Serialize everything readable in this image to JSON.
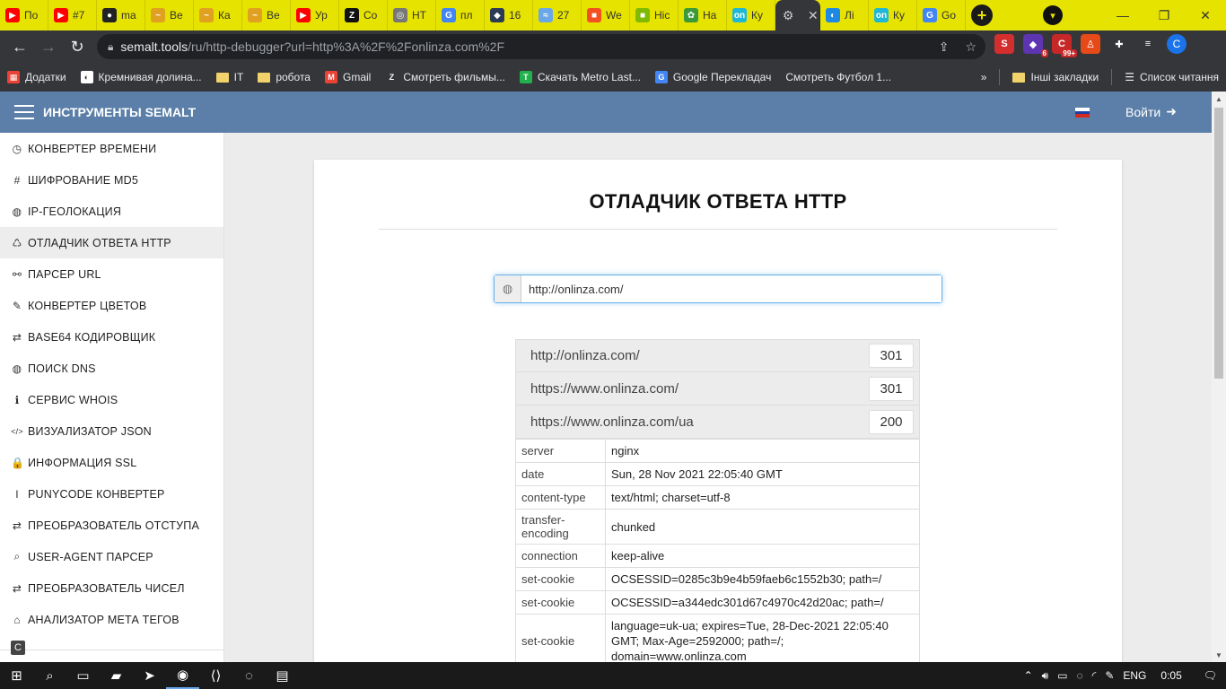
{
  "browser": {
    "tabs": [
      {
        "label": "По",
        "icon": "youtube-icon",
        "color": "#ff0000",
        "glyph": "▶"
      },
      {
        "label": "#7",
        "icon": "youtube-icon",
        "color": "#ff0000",
        "glyph": "▶"
      },
      {
        "label": "ma",
        "icon": "github-icon",
        "color": "#222222",
        "glyph": "●"
      },
      {
        "label": "Ве",
        "icon": "wavy-site-icon",
        "color": "#e0a020",
        "glyph": "~"
      },
      {
        "label": "Ка",
        "icon": "wavy-site-icon",
        "color": "#e0a020",
        "glyph": "~"
      },
      {
        "label": "Ве",
        "icon": "wavy-site-icon",
        "color": "#e0a020",
        "glyph": "~"
      },
      {
        "label": "Ур",
        "icon": "youtube-icon",
        "color": "#ff0000",
        "glyph": "▶"
      },
      {
        "label": "Co",
        "icon": "z-logo-icon",
        "color": "#111111",
        "glyph": "Z"
      },
      {
        "label": "HT",
        "icon": "globe-icon",
        "color": "#777777",
        "glyph": "◎"
      },
      {
        "label": "пл",
        "icon": "google-icon",
        "color": "#4285f4",
        "glyph": "G"
      },
      {
        "label": "16",
        "icon": "shield-icon",
        "color": "#2b3a55",
        "glyph": "◆"
      },
      {
        "label": "27",
        "icon": "feather-icon",
        "color": "#6aa7e8",
        "glyph": "≈"
      },
      {
        "label": "We",
        "icon": "microsoft-icon",
        "color": "#f25022",
        "glyph": "■"
      },
      {
        "label": "Ніс",
        "icon": "microsoft-icon",
        "color": "#7fba00",
        "glyph": "■"
      },
      {
        "label": "На",
        "icon": "leaf-icon",
        "color": "#3a9a3a",
        "glyph": "✿"
      },
      {
        "label": "Ку",
        "icon": "on-logo-icon",
        "color": "#1fb7d6",
        "glyph": "on"
      },
      {
        "label": "",
        "icon": "settings-gear-icon",
        "color": "#35363a",
        "glyph": "⚙",
        "active": true
      },
      {
        "label": "Лі",
        "icon": "chart-tab-icon",
        "color": "#1e88e5",
        "glyph": "◐"
      },
      {
        "label": "Ку",
        "icon": "on-logo-icon",
        "color": "#1fb7d6",
        "glyph": "on"
      },
      {
        "label": "Go",
        "icon": "google-translate-icon",
        "color": "#4285f4",
        "glyph": "G"
      }
    ],
    "url_host": "semalt.tools",
    "url_path": "/ru/http-debugger?url=http%3A%2F%2Fonlinza.com%2F",
    "accent_color": "#e7e300",
    "extensions": [
      {
        "icon": "semalt-ext-icon",
        "color": "#d32f2f",
        "glyph": "S",
        "badge": ""
      },
      {
        "icon": "gem-ext-icon",
        "color": "#5e35b1",
        "glyph": "◆",
        "badge": "6"
      },
      {
        "icon": "red-ext-icon",
        "color": "#c62828",
        "glyph": "C",
        "badge": "99+"
      },
      {
        "icon": "figure-ext-icon",
        "color": "#e64a19",
        "glyph": "♙",
        "badge": ""
      },
      {
        "icon": "puzzle-icon",
        "color": "#35363a",
        "glyph": "✚",
        "badge": ""
      },
      {
        "icon": "media-list-icon",
        "color": "#35363a",
        "glyph": "≡",
        "badge": ""
      }
    ],
    "avatar_letter": "C"
  },
  "bookmarks": [
    {
      "label": "Додатки",
      "icon": "apps-grid-icon",
      "color": "#ea4335"
    },
    {
      "label": "Кремнивая долина...",
      "icon": "globe-icon",
      "color": "#ffffff"
    },
    {
      "label": "IT",
      "icon": "folder-icon",
      "color": "#f2d36b"
    },
    {
      "label": "робота",
      "icon": "folder-icon",
      "color": "#f2d36b"
    },
    {
      "label": "Gmail",
      "icon": "gmail-icon",
      "color": "#ea4335"
    },
    {
      "label": "Смотреть фильмы...",
      "icon": "z-logo-icon",
      "color": "#35363a"
    },
    {
      "label": "Скачать Metro Last...",
      "icon": "t-logo-icon",
      "color": "#22b14c"
    },
    {
      "label": "Google Перекладач",
      "icon": "google-translate-icon",
      "color": "#4285f4"
    },
    {
      "label": "Смотреть Футбол 1...",
      "icon": "",
      "color": "#35363a"
    }
  ],
  "bookmarks_right": {
    "other_label": "Інші закладки",
    "reading_list_label": "Список читання"
  },
  "app": {
    "brand": "ИНСТРУМЕНТЫ SEMALT",
    "login_label": "Войти",
    "appbar_color": "#5b7fa8"
  },
  "sidebar": [
    {
      "label": "КОНВЕРТЕР ВРЕМЕНИ",
      "icon": "clock-icon",
      "glyph": "◷"
    },
    {
      "label": "ШИФРОВАНИЕ MD5",
      "icon": "hash-icon",
      "glyph": "#"
    },
    {
      "label": "IP-ГЕОЛОКАЦИЯ",
      "icon": "globe-icon",
      "glyph": "◍"
    },
    {
      "label": "ОТЛАДЧИК ОТВЕТА HTTP",
      "icon": "recycle-icon",
      "glyph": "♺",
      "active": true
    },
    {
      "label": "ПАРСЕР URL",
      "icon": "link-icon",
      "glyph": "⚯"
    },
    {
      "label": "КОНВЕРТЕР ЦВЕТОВ",
      "icon": "brush-icon",
      "glyph": "✎"
    },
    {
      "label": "BASE64 КОДИРОВЩИК",
      "icon": "exchange-icon",
      "glyph": "⇄"
    },
    {
      "label": "ПОИСК DNS",
      "icon": "globe-icon",
      "glyph": "◍"
    },
    {
      "label": "СЕРВИС WHOIS",
      "icon": "info-icon",
      "glyph": "ℹ"
    },
    {
      "label": "ВИЗУАЛИЗАТОР JSON",
      "icon": "code-icon",
      "glyph": "</>"
    },
    {
      "label": "ИНФОРМАЦИЯ SSL",
      "icon": "lock-icon",
      "glyph": "🔒"
    },
    {
      "label": "PUNYCODE КОНВЕРТЕР",
      "icon": "text-cursor-icon",
      "glyph": "I"
    },
    {
      "label": "ПРЕОБРАЗОВАТЕЛЬ ОТСТУПА",
      "icon": "exchange-icon",
      "glyph": "⇄"
    },
    {
      "label": "USER-AGENT ПАРСЕР",
      "icon": "search-icon",
      "glyph": "⌕"
    },
    {
      "label": "ПРЕОБРАЗОВАТЕЛЬ ЧИСЕЛ",
      "icon": "exchange-icon",
      "glyph": "⇄"
    },
    {
      "label": "АНАЛИЗАТОР МЕТА ТЕГОВ",
      "icon": "tag-icon",
      "glyph": "⌂"
    }
  ],
  "main": {
    "title": "ОТЛАДЧИК ОТВЕТА HTTP",
    "url_value": "http://onlinza.com/",
    "redirects": [
      {
        "url": "http://onlinza.com/",
        "code": "301"
      },
      {
        "url": "https://www.onlinza.com/",
        "code": "301"
      },
      {
        "url": "https://www.onlinza.com/ua",
        "code": "200"
      }
    ],
    "headers": [
      {
        "name": "server",
        "value": "nginx"
      },
      {
        "name": "date",
        "value": "Sun, 28 Nov 2021 22:05:40 GMT"
      },
      {
        "name": "content-type",
        "value": "text/html; charset=utf-8"
      },
      {
        "name": "transfer-encoding",
        "value": "chunked"
      },
      {
        "name": "connection",
        "value": "keep-alive"
      },
      {
        "name": "set-cookie",
        "value": "OCSESSID=0285c3b9e4b59faeb6c1552b30; path=/"
      },
      {
        "name": "set-cookie",
        "value": "OCSESSID=a344edc301d67c4970c42d20ac; path=/"
      },
      {
        "name": "set-cookie",
        "value": "language=uk-ua; expires=Tue, 28-Dec-2021 22:05:40 GMT; Max-Age=2592000; path=/; domain=www.onlinza.com"
      }
    ]
  },
  "taskbar": {
    "apps": [
      {
        "icon": "windows-start-icon",
        "glyph": "⊞"
      },
      {
        "icon": "search-icon",
        "glyph": "⌕"
      },
      {
        "icon": "task-view-icon",
        "glyph": "▭"
      },
      {
        "icon": "file-explorer-icon",
        "glyph": "▰"
      },
      {
        "icon": "telegram-icon",
        "glyph": "➤"
      },
      {
        "icon": "chrome-icon",
        "glyph": "◉",
        "running": true
      },
      {
        "icon": "vscode-icon",
        "glyph": "⟨⟩"
      },
      {
        "icon": "viber-icon",
        "glyph": "◌"
      },
      {
        "icon": "notepad-icon",
        "glyph": "▤"
      }
    ],
    "language": "ENG",
    "time": "0:05"
  }
}
